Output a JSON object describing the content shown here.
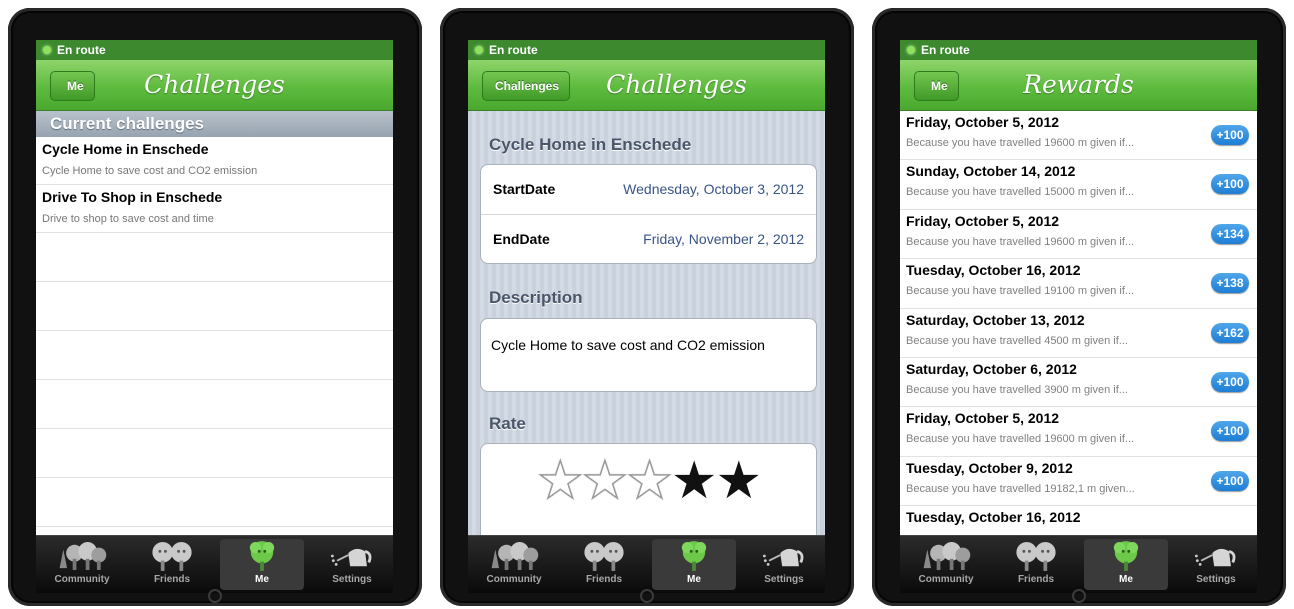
{
  "status_text": "En route",
  "tabs": [
    {
      "label": "Community",
      "icon": "community-trees-icon"
    },
    {
      "label": "Friends",
      "icon": "friends-trees-icon"
    },
    {
      "label": "Me",
      "icon": "me-tree-icon"
    },
    {
      "label": "Settings",
      "icon": "watering-can-icon"
    }
  ],
  "screen1": {
    "back": "Me",
    "title": "Challenges",
    "section": "Current challenges",
    "items": [
      {
        "title": "Cycle Home in Enschede",
        "subtitle": "Cycle Home to save cost and CO2 emission"
      },
      {
        "title": "Drive To Shop in Enschede",
        "subtitle": "Drive to shop to save cost and time"
      }
    ]
  },
  "screen2": {
    "back": "Challenges",
    "title": "Challenges",
    "challenge_title": "Cycle Home in Enschede",
    "start_label": "StartDate",
    "start_value": "Wednesday, October 3, 2012",
    "end_label": "EndDate",
    "end_value": "Friday, November 2, 2012",
    "description_label": "Description",
    "description_text": "Cycle Home to save cost and CO2 emission",
    "rate_label": "Rate",
    "rating": 3,
    "rating_max": 5
  },
  "screen3": {
    "back": "Me",
    "title": "Rewards",
    "rows": [
      {
        "date": "Friday, October 5, 2012",
        "reason": "Because you have travelled 19600 m given if...",
        "points": "+100"
      },
      {
        "date": "Sunday, October 14, 2012",
        "reason": "Because you have travelled 15000 m given if...",
        "points": "+100"
      },
      {
        "date": "Friday, October 5, 2012",
        "reason": "Because you have travelled 19600 m given if...",
        "points": "+134"
      },
      {
        "date": "Tuesday, October 16, 2012",
        "reason": "Because you have travelled 19100 m given if...",
        "points": "+138"
      },
      {
        "date": "Saturday, October 13, 2012",
        "reason": "Because you have travelled 4500 m given if...",
        "points": "+162"
      },
      {
        "date": "Saturday, October 6, 2012",
        "reason": "Because you have travelled 3900 m given if...",
        "points": "+100"
      },
      {
        "date": "Friday, October 5, 2012",
        "reason": "Because you have travelled 19600 m given if...",
        "points": "+100"
      },
      {
        "date": "Tuesday, October 9, 2012",
        "reason": "Because you have travelled 19182,1 m given...",
        "points": "+100"
      },
      {
        "date": "Tuesday, October 16, 2012",
        "reason": "",
        "points": ""
      }
    ]
  },
  "colors": {
    "nav_green": "#5dbb3e",
    "status_green": "#3d8a2e",
    "badge_blue": "#1e7ed4",
    "detail_blue": "#385487"
  }
}
